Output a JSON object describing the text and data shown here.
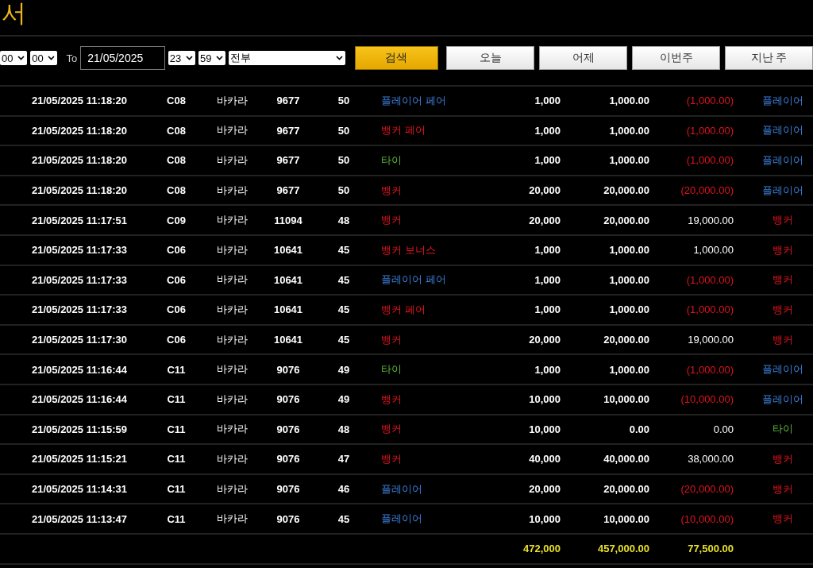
{
  "title": "서",
  "filters": {
    "from_hour": "00",
    "from_minute": "00",
    "to_label": "To",
    "to_date": "21/05/2025",
    "to_hour": "23",
    "to_minute": "59",
    "category": "전부"
  },
  "search_button": "검색",
  "quick_buttons": [
    "오늘",
    "어제",
    "이번주",
    "지난 주"
  ],
  "rows": [
    {
      "time": "21/05/2025 11:18:20",
      "table": "C08",
      "game": "바카라",
      "shoe": "9677",
      "round": "50",
      "bet": {
        "text": "플레이어 페어",
        "kind": "player"
      },
      "amount": "1,000",
      "valid": "1,000.00",
      "profit": {
        "text": "(1,000.00)",
        "negative": true
      },
      "result": {
        "text": "플레이어",
        "kind": "player"
      }
    },
    {
      "time": "21/05/2025 11:18:20",
      "table": "C08",
      "game": "바카라",
      "shoe": "9677",
      "round": "50",
      "bet": {
        "text": "뱅커 페어",
        "kind": "banker"
      },
      "amount": "1,000",
      "valid": "1,000.00",
      "profit": {
        "text": "(1,000.00)",
        "negative": true
      },
      "result": {
        "text": "플레이어",
        "kind": "player"
      }
    },
    {
      "time": "21/05/2025 11:18:20",
      "table": "C08",
      "game": "바카라",
      "shoe": "9677",
      "round": "50",
      "bet": {
        "text": "타이",
        "kind": "tie"
      },
      "amount": "1,000",
      "valid": "1,000.00",
      "profit": {
        "text": "(1,000.00)",
        "negative": true
      },
      "result": {
        "text": "플레이어",
        "kind": "player"
      }
    },
    {
      "time": "21/05/2025 11:18:20",
      "table": "C08",
      "game": "바카라",
      "shoe": "9677",
      "round": "50",
      "bet": {
        "text": "뱅커",
        "kind": "banker"
      },
      "amount": "20,000",
      "valid": "20,000.00",
      "profit": {
        "text": "(20,000.00)",
        "negative": true
      },
      "result": {
        "text": "플레이어",
        "kind": "player"
      }
    },
    {
      "time": "21/05/2025 11:17:51",
      "table": "C09",
      "game": "바카라",
      "shoe": "11094",
      "round": "48",
      "bet": {
        "text": "뱅커",
        "kind": "banker"
      },
      "amount": "20,000",
      "valid": "20,000.00",
      "profit": {
        "text": "19,000.00",
        "negative": false
      },
      "result": {
        "text": "뱅커",
        "kind": "banker"
      }
    },
    {
      "time": "21/05/2025 11:17:33",
      "table": "C06",
      "game": "바카라",
      "shoe": "10641",
      "round": "45",
      "bet": {
        "text": "뱅커 보너스",
        "kind": "banker"
      },
      "amount": "1,000",
      "valid": "1,000.00",
      "profit": {
        "text": "1,000.00",
        "negative": false
      },
      "result": {
        "text": "뱅커",
        "kind": "banker"
      }
    },
    {
      "time": "21/05/2025 11:17:33",
      "table": "C06",
      "game": "바카라",
      "shoe": "10641",
      "round": "45",
      "bet": {
        "text": "플레이어 페어",
        "kind": "player"
      },
      "amount": "1,000",
      "valid": "1,000.00",
      "profit": {
        "text": "(1,000.00)",
        "negative": true
      },
      "result": {
        "text": "뱅커",
        "kind": "banker"
      }
    },
    {
      "time": "21/05/2025 11:17:33",
      "table": "C06",
      "game": "바카라",
      "shoe": "10641",
      "round": "45",
      "bet": {
        "text": "뱅커 페어",
        "kind": "banker"
      },
      "amount": "1,000",
      "valid": "1,000.00",
      "profit": {
        "text": "(1,000.00)",
        "negative": true
      },
      "result": {
        "text": "뱅커",
        "kind": "banker"
      }
    },
    {
      "time": "21/05/2025 11:17:30",
      "table": "C06",
      "game": "바카라",
      "shoe": "10641",
      "round": "45",
      "bet": {
        "text": "뱅커",
        "kind": "banker"
      },
      "amount": "20,000",
      "valid": "20,000.00",
      "profit": {
        "text": "19,000.00",
        "negative": false
      },
      "result": {
        "text": "뱅커",
        "kind": "banker"
      }
    },
    {
      "time": "21/05/2025 11:16:44",
      "table": "C11",
      "game": "바카라",
      "shoe": "9076",
      "round": "49",
      "bet": {
        "text": "타이",
        "kind": "tie"
      },
      "amount": "1,000",
      "valid": "1,000.00",
      "profit": {
        "text": "(1,000.00)",
        "negative": true
      },
      "result": {
        "text": "플레이어",
        "kind": "player"
      }
    },
    {
      "time": "21/05/2025 11:16:44",
      "table": "C11",
      "game": "바카라",
      "shoe": "9076",
      "round": "49",
      "bet": {
        "text": "뱅커",
        "kind": "banker"
      },
      "amount": "10,000",
      "valid": "10,000.00",
      "profit": {
        "text": "(10,000.00)",
        "negative": true
      },
      "result": {
        "text": "플레이어",
        "kind": "player"
      }
    },
    {
      "time": "21/05/2025 11:15:59",
      "table": "C11",
      "game": "바카라",
      "shoe": "9076",
      "round": "48",
      "bet": {
        "text": "뱅커",
        "kind": "banker"
      },
      "amount": "10,000",
      "valid": "0.00",
      "profit": {
        "text": "0.00",
        "negative": false
      },
      "result": {
        "text": "타이",
        "kind": "tie"
      }
    },
    {
      "time": "21/05/2025 11:15:21",
      "table": "C11",
      "game": "바카라",
      "shoe": "9076",
      "round": "47",
      "bet": {
        "text": "뱅커",
        "kind": "banker"
      },
      "amount": "40,000",
      "valid": "40,000.00",
      "profit": {
        "text": "38,000.00",
        "negative": false
      },
      "result": {
        "text": "뱅커",
        "kind": "banker"
      }
    },
    {
      "time": "21/05/2025 11:14:31",
      "table": "C11",
      "game": "바카라",
      "shoe": "9076",
      "round": "46",
      "bet": {
        "text": "플레이어",
        "kind": "player"
      },
      "amount": "20,000",
      "valid": "20,000.00",
      "profit": {
        "text": "(20,000.00)",
        "negative": true
      },
      "result": {
        "text": "뱅커",
        "kind": "banker"
      }
    },
    {
      "time": "21/05/2025 11:13:47",
      "table": "C11",
      "game": "바카라",
      "shoe": "9076",
      "round": "45",
      "bet": {
        "text": "플레이어",
        "kind": "player"
      },
      "amount": "10,000",
      "valid": "10,000.00",
      "profit": {
        "text": "(10,000.00)",
        "negative": true
      },
      "result": {
        "text": "뱅커",
        "kind": "banker"
      }
    }
  ],
  "totals": {
    "amount": "472,000",
    "valid": "457,000.00",
    "profit": "77,500.00"
  }
}
